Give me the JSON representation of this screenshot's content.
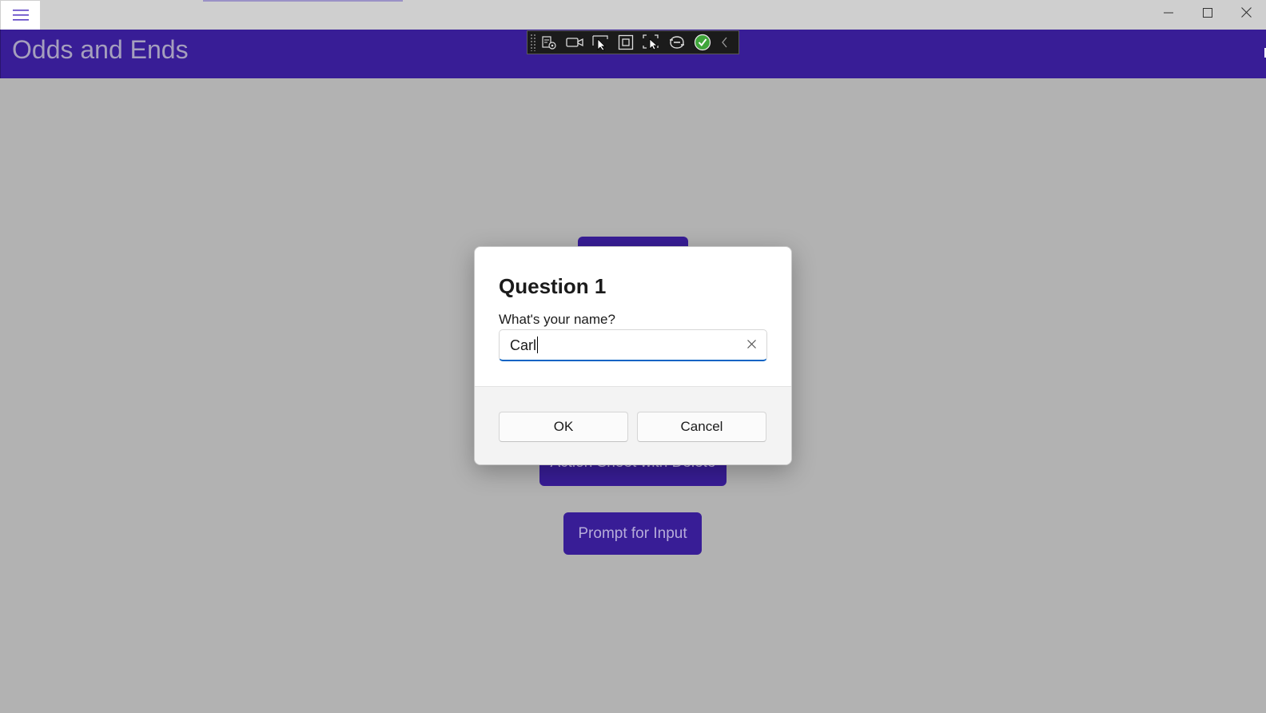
{
  "app": {
    "page_title": "Odds and Ends",
    "header_color": "#381d96",
    "overlay_color": "#b2b2b2"
  },
  "titlebar": {
    "menu_icon": "hamburger-icon",
    "minimize_icon": "minimize-icon",
    "maximize_icon": "maximize-icon",
    "close_icon": "close-icon"
  },
  "debug_toolbar": {
    "icons": [
      "live-visual-tree-icon",
      "record-icon",
      "select-element-icon",
      "display-layout-adorners-icon",
      "track-focus-icon",
      "binding-failures-icon",
      "hot-reload-status-icon",
      "collapse-chevron-icon"
    ]
  },
  "background_buttons": {
    "top_label": "",
    "action_sheet_label": "Action Sheet with Delete",
    "prompt_label": "Prompt for Input"
  },
  "dialog": {
    "title": "Question 1",
    "prompt": "What's your name?",
    "input_value": "Carl",
    "ok_label": "OK",
    "cancel_label": "Cancel",
    "accent_color": "#0b63c4"
  }
}
